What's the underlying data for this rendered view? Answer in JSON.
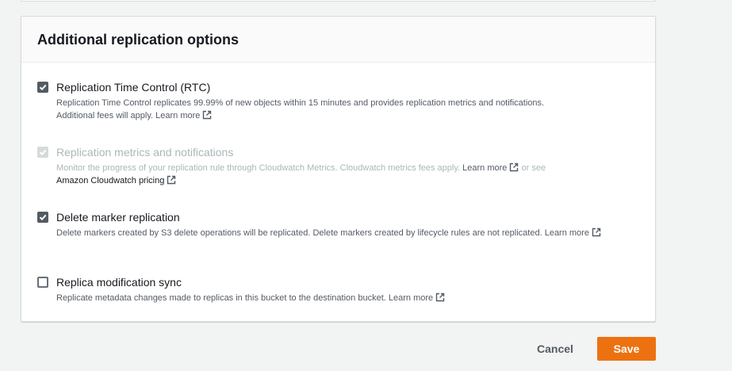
{
  "panel": {
    "title": "Additional replication options"
  },
  "options": [
    {
      "label": "Replication Time Control (RTC)",
      "desc_line1": "Replication Time Control replicates 99.99% of new objects within 15 minutes and provides replication metrics and notifications.",
      "desc_line2": "Additional fees will apply.",
      "link": "Learn more",
      "checked": true,
      "disabled": false
    },
    {
      "label": "Replication metrics and notifications",
      "desc_line1": "Monitor the progress of your replication rule through Cloudwatch Metrics. Cloudwatch metrics fees apply.",
      "link": "Learn more",
      "or_see": "or see",
      "link2": "Amazon Cloudwatch pricing",
      "checked": true,
      "disabled": true
    },
    {
      "label": "Delete marker replication",
      "desc_line1": "Delete markers created by S3 delete operations will be replicated. Delete markers created by lifecycle rules are not replicated.",
      "link": "Learn more",
      "checked": true,
      "disabled": false
    },
    {
      "label": "Replica modification sync",
      "desc_line1": "Replicate metadata changes made to replicas in this bucket to the destination bucket.",
      "link": "Learn more",
      "checked": false,
      "disabled": false
    }
  ],
  "actions": {
    "cancel_label": "Cancel",
    "save_label": "Save"
  },
  "colors": {
    "primary_button": "#ec7211",
    "checkbox_checked": "#545b64",
    "checkbox_disabled": "#d5dbdb"
  }
}
